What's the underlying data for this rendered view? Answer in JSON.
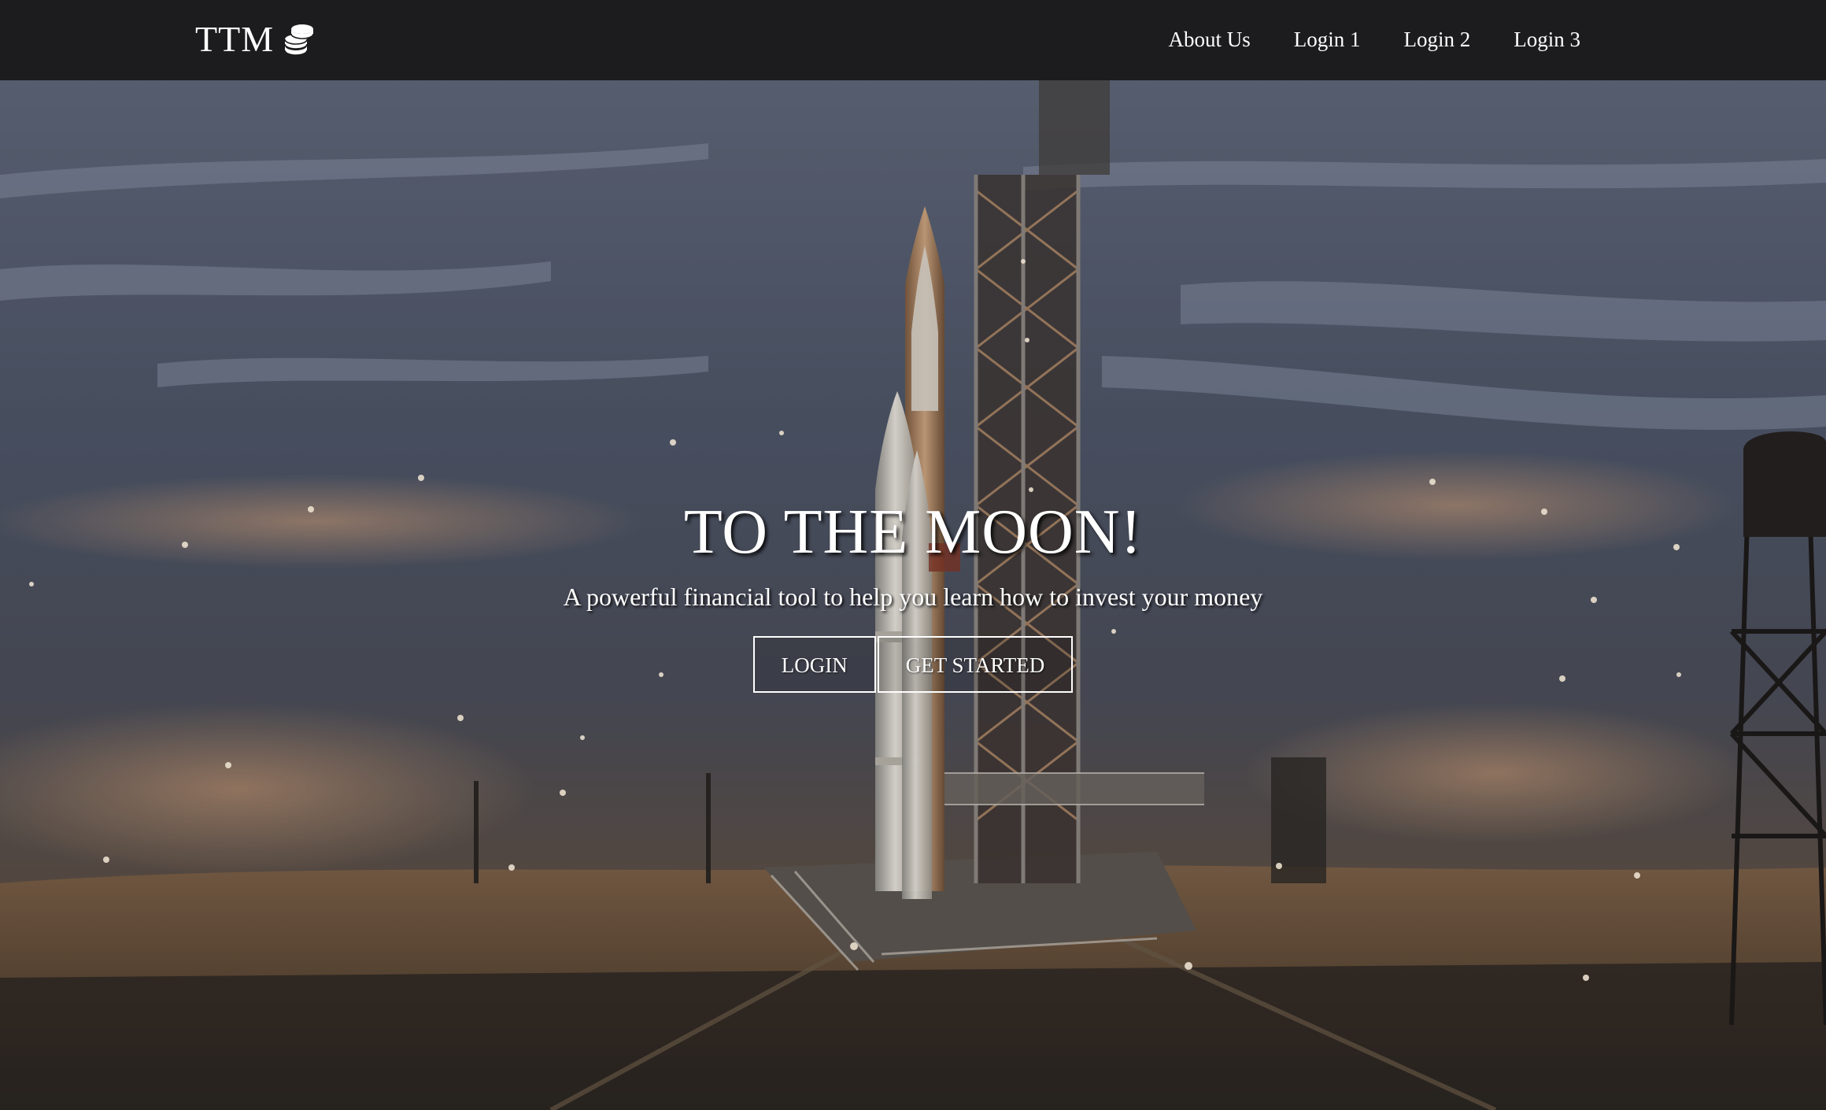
{
  "navbar": {
    "brand": "TTM",
    "brand_icon": "coins-icon",
    "links": [
      {
        "label": "About Us"
      },
      {
        "label": "Login 1"
      },
      {
        "label": "Login 2"
      },
      {
        "label": "Login 3"
      }
    ],
    "background": "#1c1b1d"
  },
  "hero": {
    "title": "TO THE MOON!",
    "subtitle": "A powerful financial tool to help you learn how to invest your money",
    "buttons": {
      "login": "LOGIN",
      "get_started": "GET STARTED"
    },
    "background_image": "rocket-launch-pad-photo"
  }
}
